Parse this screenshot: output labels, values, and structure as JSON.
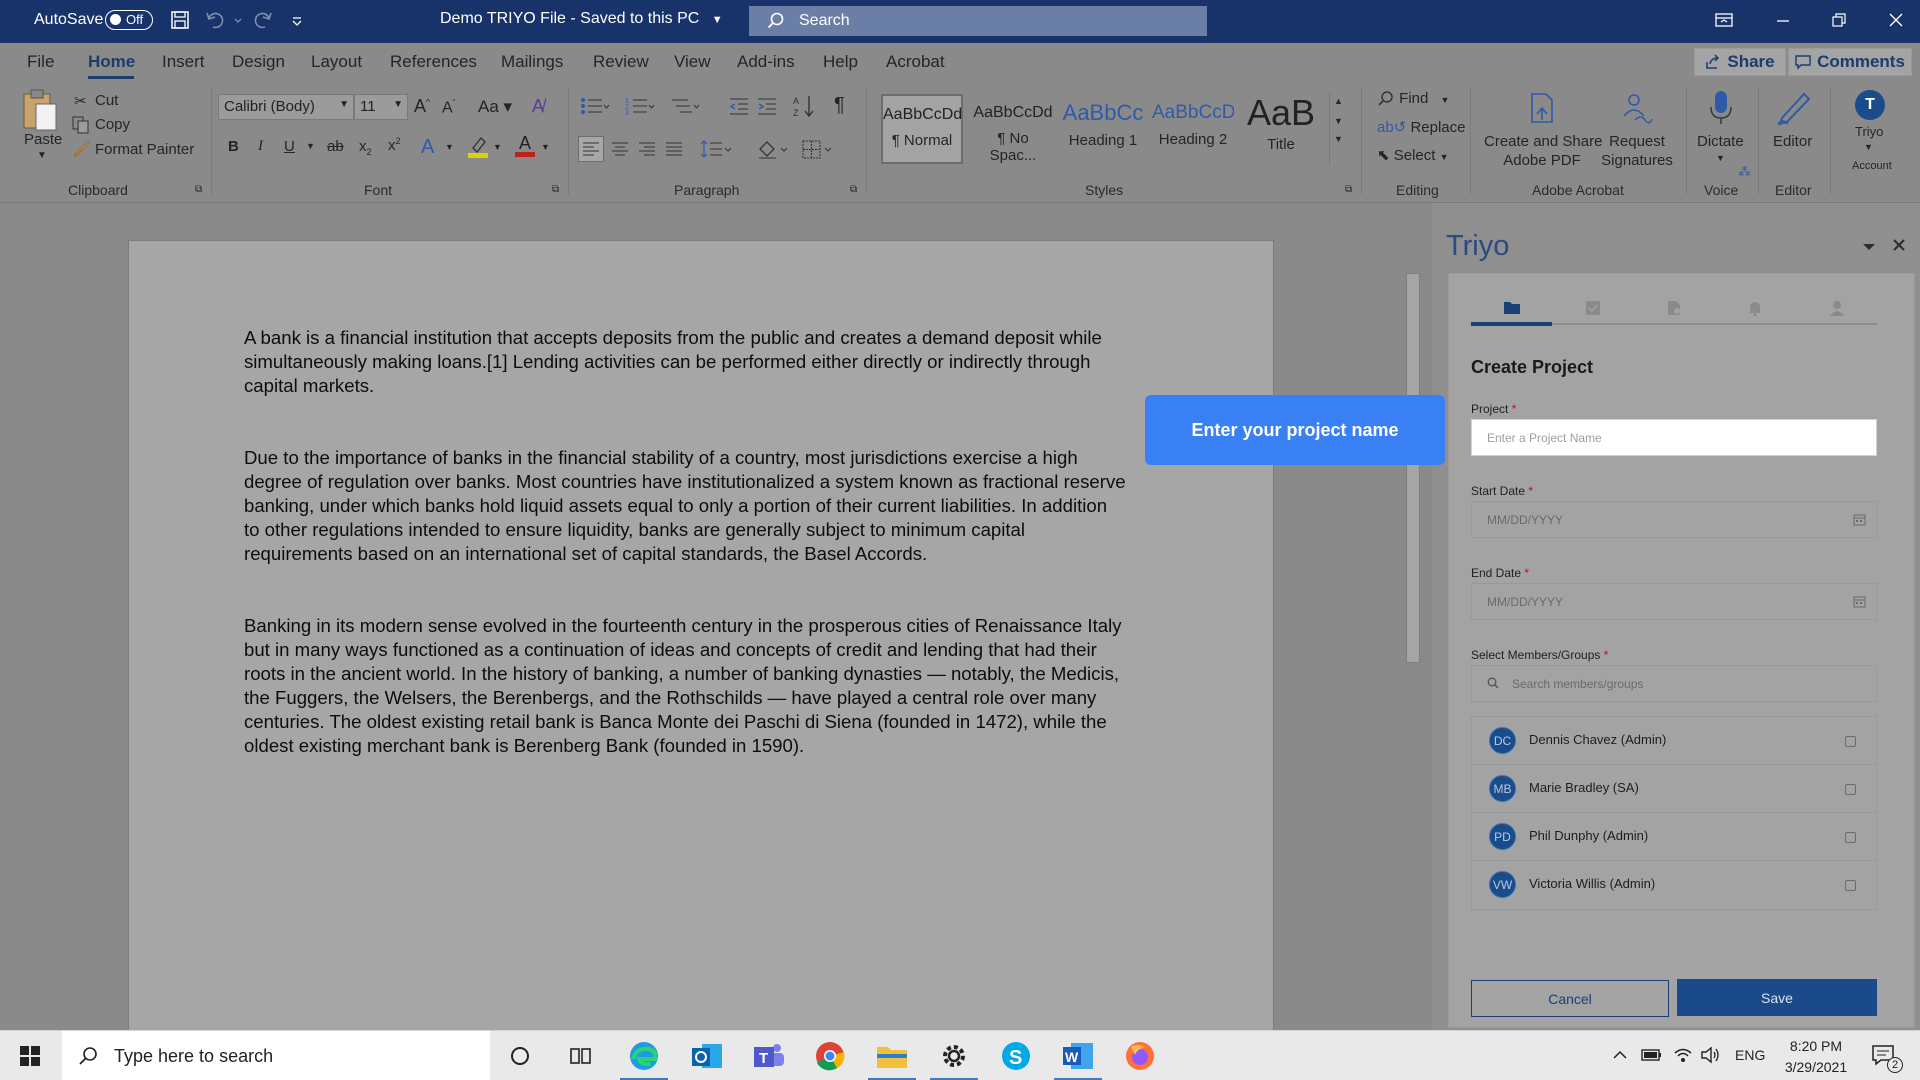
{
  "titlebar": {
    "autosave_label": "AutoSave",
    "autosave_state": "Off",
    "doc_title": "Demo TRIYO File  -  Saved to this PC",
    "search_placeholder": "Search"
  },
  "menu": {
    "tabs": [
      "File",
      "Home",
      "Insert",
      "Design",
      "Layout",
      "References",
      "Mailings",
      "Review",
      "View",
      "Add-ins",
      "Help",
      "Acrobat"
    ],
    "active": "Home",
    "share_label": "Share",
    "comments_label": "Comments"
  },
  "ribbon": {
    "clipboard": {
      "paste": "Paste",
      "cut": "Cut",
      "copy": "Copy",
      "format_painter": "Format Painter",
      "label": "Clipboard"
    },
    "font": {
      "name": "Calibri (Body)",
      "size": "11",
      "label": "Font"
    },
    "paragraph": {
      "label": "Paragraph"
    },
    "styles": {
      "items": [
        {
          "preview": "AaBbCcDd",
          "name": "¶ Normal"
        },
        {
          "preview": "AaBbCcDd",
          "name": "¶ No Spac..."
        },
        {
          "preview": "AaBbCc",
          "name": "Heading 1"
        },
        {
          "preview": "AaBbCcD",
          "name": "Heading 2"
        },
        {
          "preview": "AaB",
          "name": "Title"
        }
      ],
      "label": "Styles"
    },
    "editing": {
      "find": "Find",
      "replace": "Replace",
      "select": "Select",
      "label": "Editing"
    },
    "acrobat": {
      "create_share": "Create and Share",
      "adobe_pdf": "Adobe PDF",
      "request": "Request",
      "signatures": "Signatures",
      "label": "Adobe Acrobat"
    },
    "voice": {
      "dictate": "Dictate",
      "label": "Voice"
    },
    "editor": {
      "editor": "Editor",
      "label": "Editor"
    },
    "account": {
      "triyo": "Triyo",
      "label": "Account",
      "initial": "T"
    }
  },
  "document": {
    "paragraphs": [
      [
        "A bank is a financial institution that accepts deposits from the public and creates a demand deposit while",
        "simultaneously making loans.[1] Lending activities can be performed either directly or indirectly through",
        "capital markets."
      ],
      [
        "Due to the importance of banks in the financial stability of a country, most jurisdictions exercise a high",
        "degree of regulation over banks. Most countries have institutionalized a system known as fractional reserve",
        "banking, under which banks hold liquid assets equal to only a portion of their current liabilities. In addition",
        "to other regulations intended to ensure liquidity, banks are generally subject to minimum capital",
        "requirements based on an international set of capital standards, the Basel Accords."
      ],
      [
        "Banking in its modern sense evolved in the fourteenth century in the prosperous cities of Renaissance Italy",
        "but in many ways functioned as a continuation of ideas and concepts of credit and lending that had their",
        "roots in the ancient world. In the history of banking, a number of banking dynasties — notably, the Medicis,",
        "the Fuggers, the Welsers, the Berenbergs, and the Rothschilds — have played a central role over many",
        "centuries. The oldest existing retail bank is Banca Monte dei Paschi di Siena (founded in 1472), while the",
        "oldest existing merchant bank is Berenberg Bank (founded in 1590)."
      ]
    ]
  },
  "pane": {
    "title": "Triyo",
    "tooltip": "Enter your project name",
    "form_title": "Create Project",
    "project_label": "Project",
    "project_placeholder": "Enter a Project Name",
    "start_label": "Start Date",
    "start_placeholder": "MM/DD/YYYY",
    "end_label": "End Date",
    "end_placeholder": "MM/DD/YYYY",
    "members_label": "Select Members/Groups",
    "members_placeholder": "Search members/groups",
    "required_mark": "*",
    "members": [
      {
        "initials": "DC",
        "name": "Dennis Chavez (Admin)"
      },
      {
        "initials": "MB",
        "name": "Marie Bradley (SA)"
      },
      {
        "initials": "PD",
        "name": "Phil Dunphy (Admin)"
      },
      {
        "initials": "VW",
        "name": "Victoria Willis (Admin)"
      }
    ],
    "cancel_label": "Cancel",
    "save_label": "Save"
  },
  "taskbar": {
    "search_placeholder": "Type here to search",
    "language": "ENG",
    "time": "8:20 PM",
    "date": "3/29/2021",
    "notifications": "2"
  },
  "colors": {
    "titlebar": "#18336a",
    "accent": "#1a3f75",
    "tooltip": "#3a80f5"
  }
}
